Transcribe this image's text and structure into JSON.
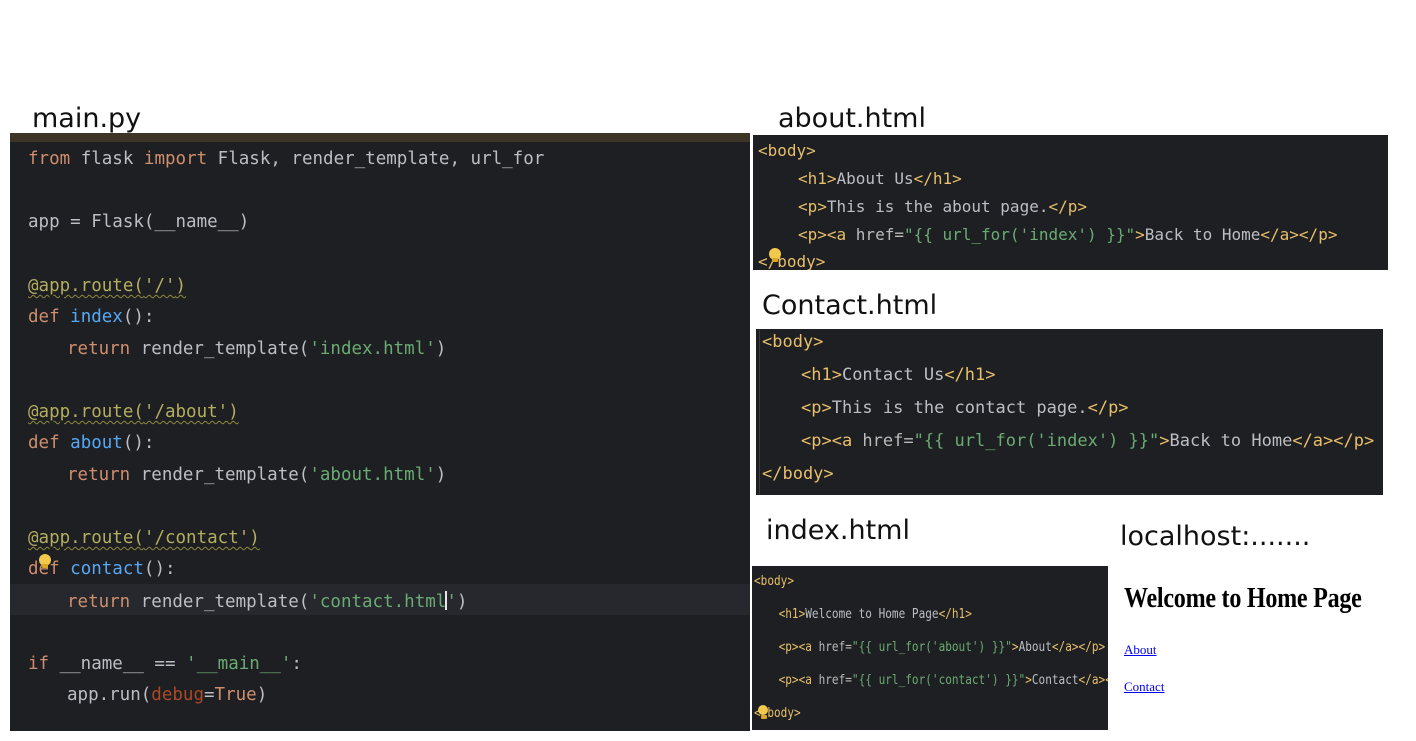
{
  "captions": {
    "main": "main.py",
    "about": "about.html",
    "contact": "Contact.html",
    "index": "index.html",
    "localhost": "localhost:......."
  },
  "main_py": {
    "l1": {
      "a": "from",
      "b": " flask ",
      "c": "import",
      "d": " Flask, render_template, url_for"
    },
    "l3": {
      "a": "app = Flask(__name__)"
    },
    "l5": {
      "a": "@app.route(",
      "b": "'/'",
      "c": ")"
    },
    "l6": {
      "a": "def",
      "b": " ",
      "c": "index",
      "d": "():"
    },
    "l7": {
      "a": "return",
      "b": " render_template(",
      "c": "'index.html'",
      "d": ")"
    },
    "l9": {
      "a": "@app.route(",
      "b": "'/about'",
      "c": ")"
    },
    "l10": {
      "a": "def",
      "b": " ",
      "c": "about",
      "d": "():"
    },
    "l11": {
      "a": "return",
      "b": " render_template(",
      "c": "'about.html'",
      "d": ")"
    },
    "l13": {
      "a": "@app.route(",
      "b": "'/contact'",
      "c": ")"
    },
    "l14": {
      "a": "def",
      "b": " ",
      "c": "contact",
      "d": "():"
    },
    "l15": {
      "a": "return",
      "b": " render_template(",
      "c": "'contact.html",
      "c2": "'",
      "d": ")"
    },
    "l17": {
      "a": "if",
      "b": " __name__ == ",
      "c": "'__main__'",
      "d": ":"
    },
    "l18": {
      "a": "app.run(",
      "b": "debug",
      "c": "=",
      "d": "True",
      "e": ")"
    }
  },
  "about_html": {
    "l1": "<body>",
    "l2": {
      "o": "<h1>",
      "t": "About Us",
      "c": "</h1>"
    },
    "l3": {
      "o": "<p>",
      "t": "This is the about page.",
      "c": "</p>"
    },
    "l4": {
      "o": "<p><a ",
      "a": "href=",
      "v": "\"{{ url_for('index') }}\"",
      "o2": ">",
      "t": "Back to Home",
      "c": "</a></p>"
    },
    "l5": "</body>"
  },
  "contact_html": {
    "l1": "<body>",
    "l2": {
      "o": "<h1>",
      "t": "Contact Us",
      "c": "</h1>"
    },
    "l3": {
      "o": "<p>",
      "t": "This is the contact page.",
      "c": "</p>"
    },
    "l4": {
      "o": "<p><a ",
      "a": "href=",
      "v": "\"{{ url_for('index') }}\"",
      "o2": ">",
      "t": "Back to Home",
      "c": "</a></p>"
    },
    "l5": "</body>"
  },
  "index_html": {
    "l1": "<body>",
    "l2": {
      "o": "<h1>",
      "t": "Welcome to Home Page",
      "c": "</h1>"
    },
    "l3": {
      "o": "<p><a ",
      "a": "href=",
      "v": "\"{{ url_for('about') }}\"",
      "o2": ">",
      "t": "About",
      "c": "</a></p>"
    },
    "l4": {
      "o": "<p><a ",
      "a": "href=",
      "v": "\"{{ url_for('contact') }}\"",
      "o2": ">",
      "t": "Contact",
      "c": "</a></p>"
    },
    "l5": "</body>"
  },
  "browser": {
    "heading": "Welcome to Home Page",
    "link_about": "About",
    "link_contact": "Contact"
  },
  "colors": {
    "editor_bg": "#1e1f22",
    "keyword": "#cf8e6d",
    "function": "#56a8f5",
    "string": "#6aab73",
    "tag": "#e8bf6a",
    "link": "#0000ee"
  }
}
